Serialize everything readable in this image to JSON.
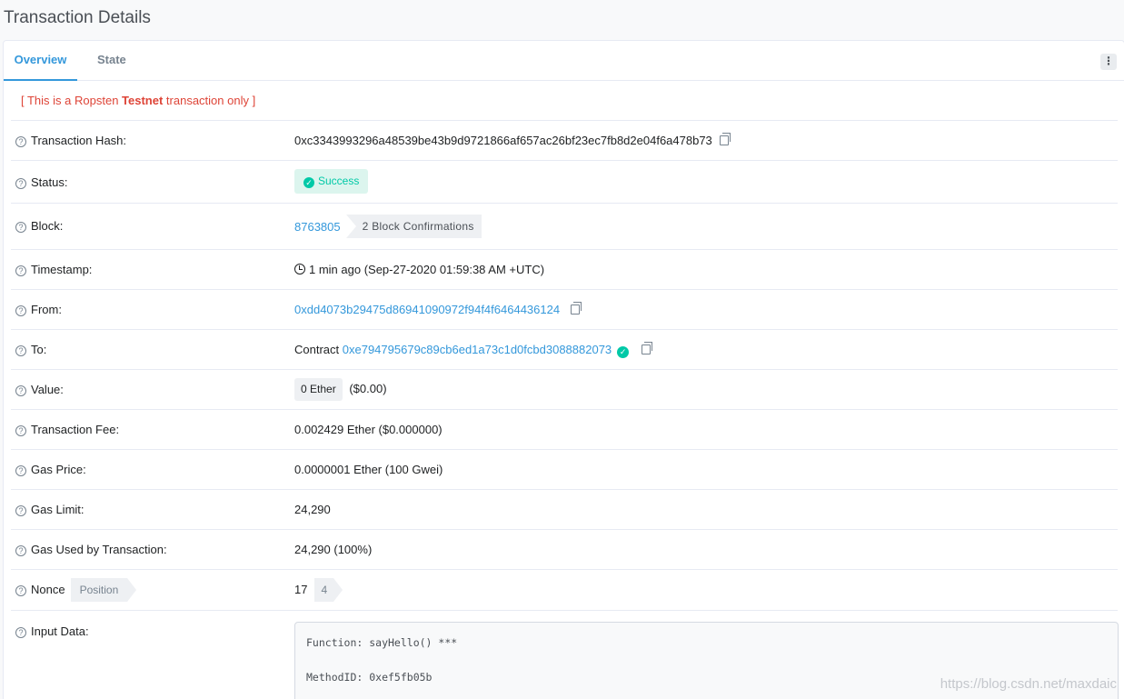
{
  "page": {
    "title": "Transaction Details"
  },
  "tabs": [
    {
      "label": "Overview",
      "active": true
    },
    {
      "label": "State",
      "active": false
    }
  ],
  "more_icon": "vertical-dots-icon",
  "notice": {
    "prefix": "[ This is a Ropsten ",
    "bold": "Testnet",
    "suffix": " transaction only ]"
  },
  "fields": {
    "tx_hash": {
      "label": "Transaction Hash:",
      "value": "0xc3343993296a48539be43b9d9721866af657ac26bf23ec7fb8d2e04f6a478b73"
    },
    "status": {
      "label": "Status:",
      "value": "Success"
    },
    "block": {
      "label": "Block:",
      "value": "8763805",
      "confirmations": "2 Block Confirmations"
    },
    "timestamp": {
      "label": "Timestamp:",
      "value": "1 min ago (Sep-27-2020 01:59:38 AM +UTC)"
    },
    "from": {
      "label": "From:",
      "value": "0xdd4073b29475d86941090972f94f4f6464436124"
    },
    "to": {
      "label": "To:",
      "prefix": "Contract",
      "value": "0xe794795679c89cb6ed1a73c1d0fcbd3088882073"
    },
    "value": {
      "label": "Value:",
      "badge": "0 Ether",
      "usd": "($0.00)"
    },
    "fee": {
      "label": "Transaction Fee:",
      "value": "0.002429 Ether ($0.000000)"
    },
    "gas_price": {
      "label": "Gas Price:",
      "value": "0.0000001 Ether (100 Gwei)"
    },
    "gas_limit": {
      "label": "Gas Limit:",
      "value": "24,290"
    },
    "gas_used": {
      "label": "Gas Used by Transaction:",
      "value": "24,290 (100%)"
    },
    "nonce": {
      "label": "Nonce",
      "position_label": "Position",
      "value": "17",
      "position": "4"
    },
    "input_data": {
      "label": "Input Data:",
      "function": "Function: sayHello() ***",
      "method_id": "MethodID: 0xef5fb05b"
    }
  },
  "watermark": "https://blog.csdn.net/maxdaic",
  "colors": {
    "link": "#3498db",
    "success": "#00c9a7",
    "testnet_red": "#de4437"
  }
}
